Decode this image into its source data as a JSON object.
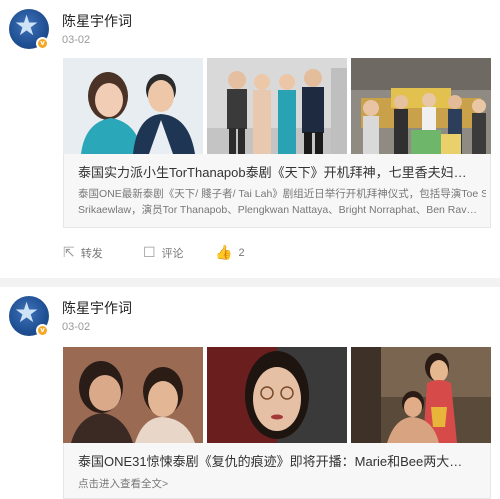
{
  "posts": [
    {
      "author": "陈星宇作词",
      "date": "03-02",
      "article": {
        "title": "泰国实力派小生TorThanapob泰剧《天下》开机拜神，七里香夫妇…",
        "desc_line1": "泰国ONE最新泰剧《天下/ 賤子者/ Tai Lah》剧组近日举行开机拜神仪式，包括导演Toe Sant",
        "desc_line2": "Srikaewlaw，演员Tor Thanapob、Plengkwan Nattaya、Bright Norraphat、Ben Rav…"
      },
      "actions": {
        "forward": "转发",
        "comment": "评论",
        "like_count": "2"
      }
    },
    {
      "author": "陈星宇作词",
      "date": "03-02",
      "article": {
        "title": "泰国ONE31惊悚泰剧《复仇的痕迹》即将开播：Marie和Bee两大…",
        "more": "点击进入查看全文>"
      }
    }
  ],
  "icons": {
    "forward": "share-icon",
    "comment": "comment-icon",
    "like": "thumbs-up-icon",
    "verified": "verified-badge-icon"
  }
}
